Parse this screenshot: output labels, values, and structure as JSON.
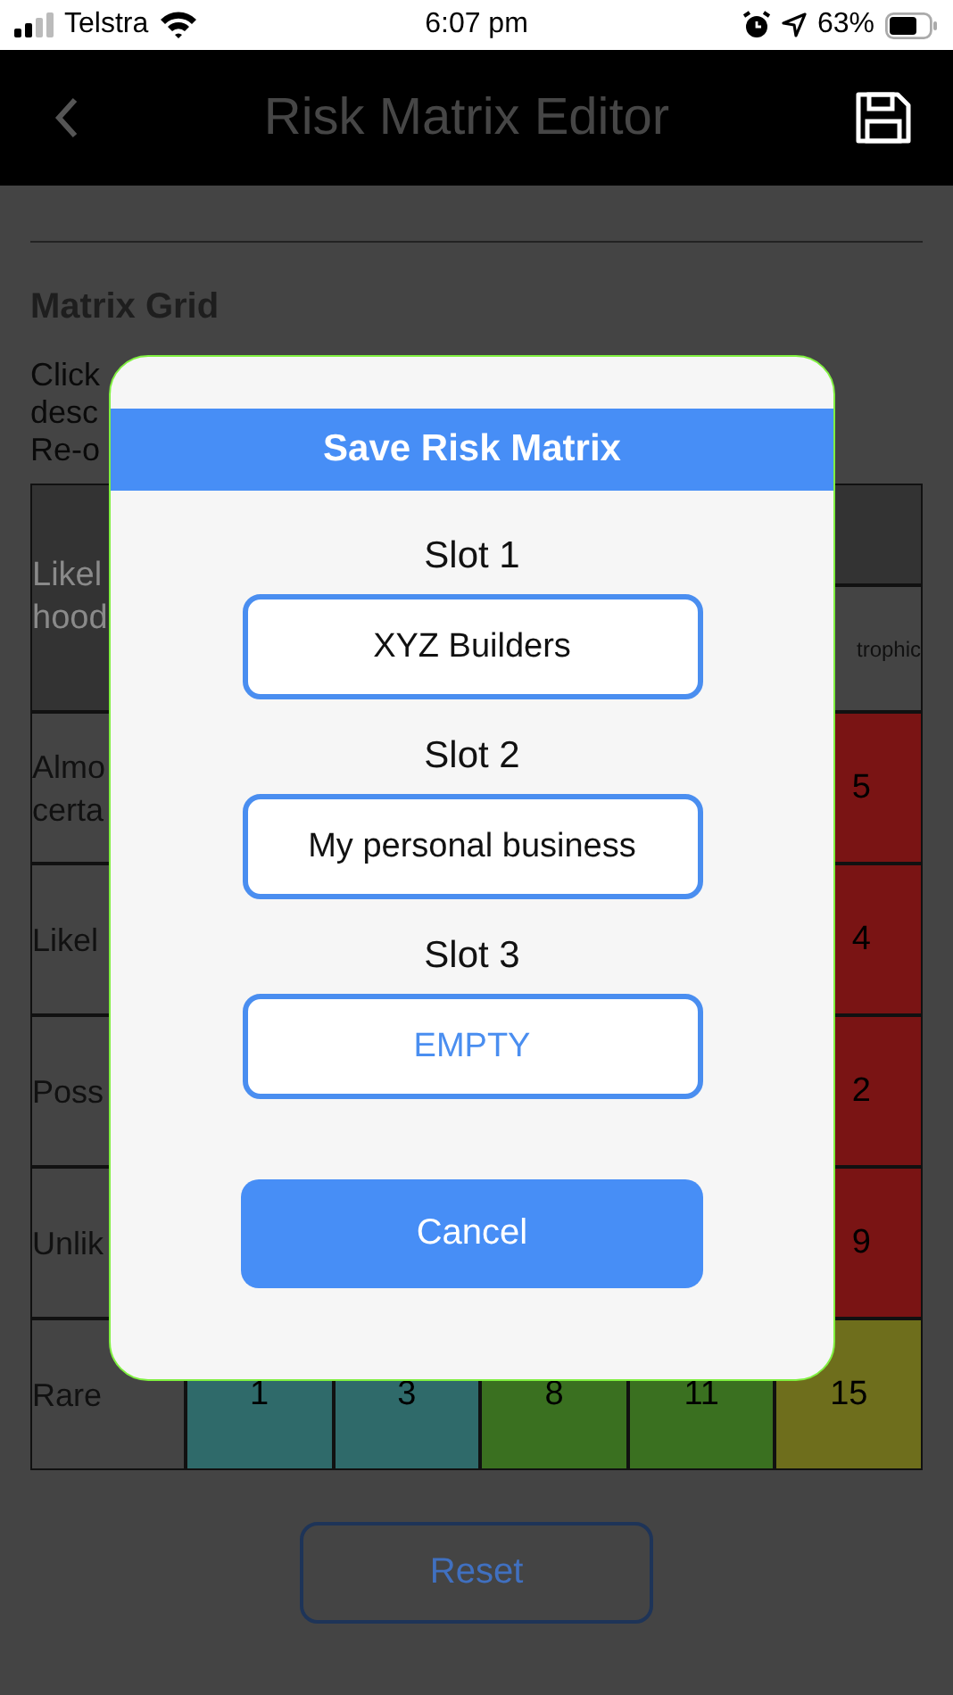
{
  "status_bar": {
    "carrier": "Telstra",
    "time": "6:07 pm",
    "battery": "63%"
  },
  "header": {
    "title": "Risk Matrix Editor"
  },
  "section": {
    "title": "Matrix Grid",
    "description_lines": [
      "Click",
      "desc",
      "Re-o"
    ]
  },
  "matrix": {
    "corner_lines": [
      "Likel",
      "hood"
    ],
    "impact_label": "trophic",
    "rows": [
      {
        "label_lines": [
          "Almo",
          "certa"
        ],
        "cells": [
          {
            "value": "5",
            "color": "#7a1414"
          }
        ]
      },
      {
        "label_lines": [
          "Likel"
        ],
        "cells": [
          {
            "value": "4",
            "color": "#7a1414"
          }
        ]
      },
      {
        "label_lines": [
          "Poss"
        ],
        "cells": [
          {
            "value": "2",
            "color": "#7a1414"
          }
        ]
      },
      {
        "label_lines": [
          "Unlik"
        ],
        "cells": [
          {
            "value": "9",
            "color": "#7a1414"
          }
        ]
      },
      {
        "label_lines": [
          "Rare"
        ],
        "cells": [
          {
            "value": "1",
            "color": "#2f6a6a"
          },
          {
            "value": "3",
            "color": "#2f6a6a"
          },
          {
            "value": "8",
            "color": "#3a7020"
          },
          {
            "value": "11",
            "color": "#3a7020"
          },
          {
            "value": "15",
            "color": "#6e6e1c"
          }
        ]
      }
    ]
  },
  "reset_button": "Reset",
  "dialog": {
    "title": "Save Risk Matrix",
    "slots": [
      {
        "label": "Slot 1",
        "value": "XYZ Builders",
        "empty": false
      },
      {
        "label": "Slot 2",
        "value": "My personal business",
        "empty": false
      },
      {
        "label": "Slot 3",
        "value": "EMPTY",
        "empty": true
      }
    ],
    "cancel": "Cancel"
  }
}
